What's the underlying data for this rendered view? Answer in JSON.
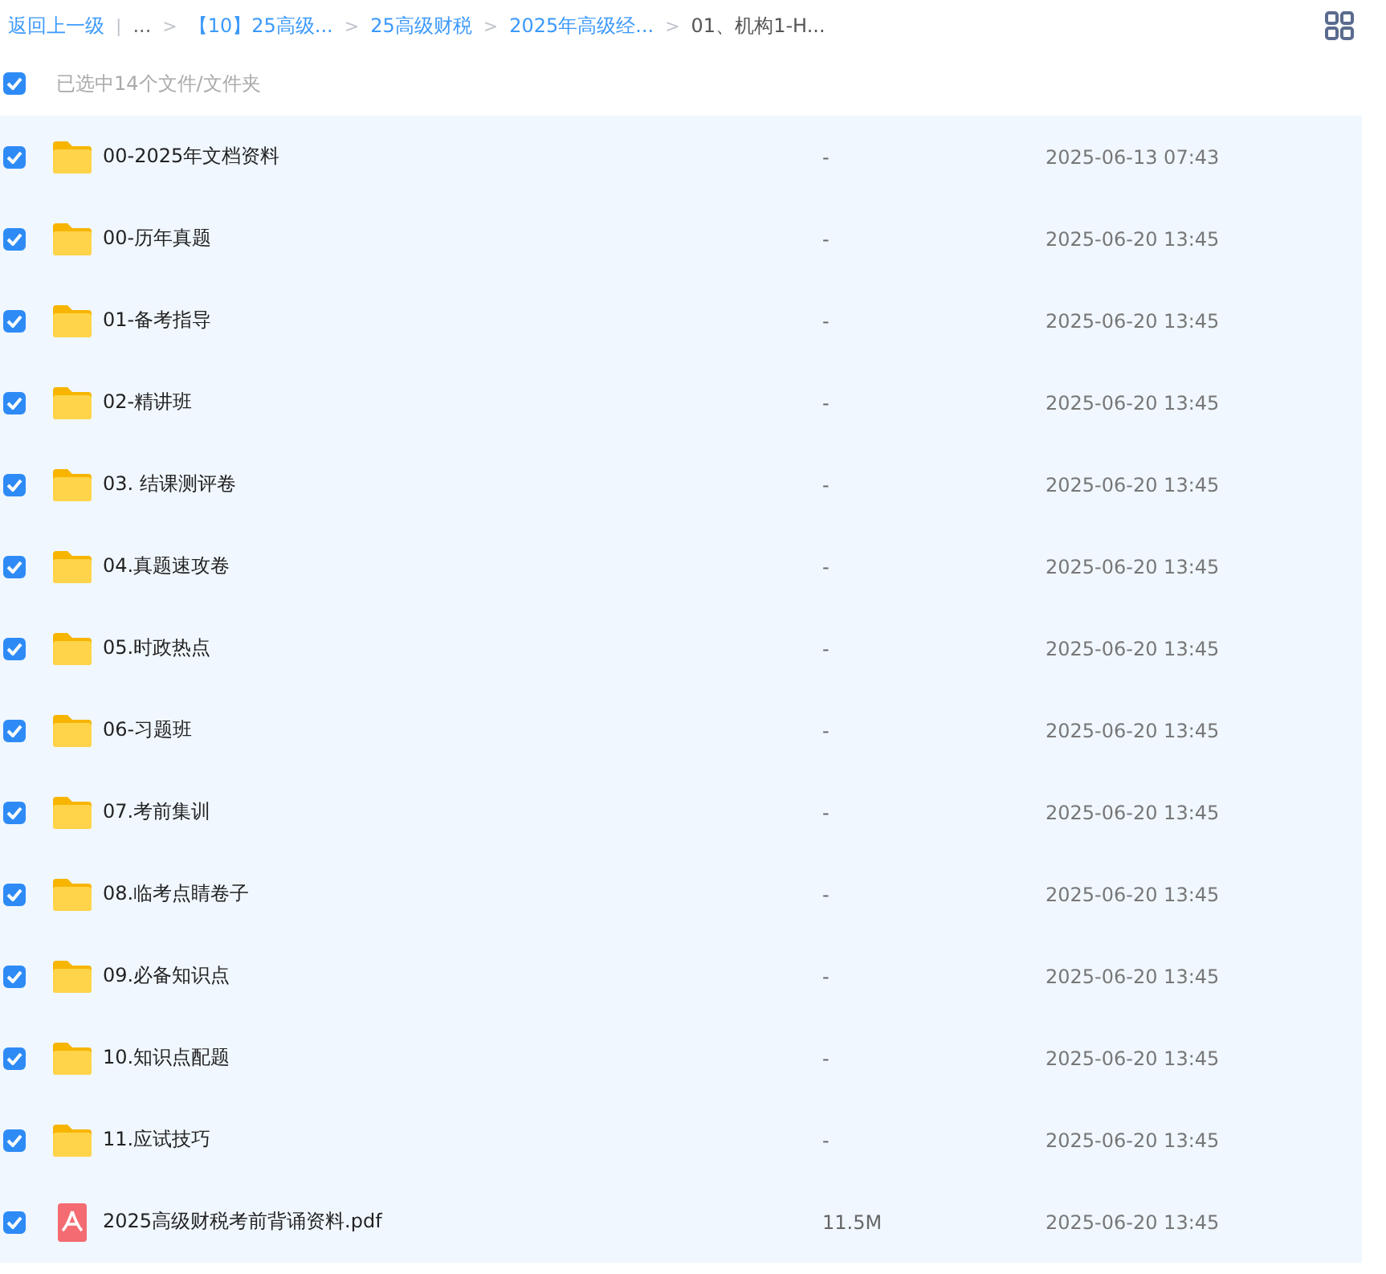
{
  "breadcrumb": {
    "back": "返回上一级",
    "divider": "|",
    "items": [
      {
        "label": "...",
        "kind": "ellipsis"
      },
      {
        "sep": ">",
        "label": "【10】25高级...",
        "kind": "link"
      },
      {
        "sep": ">",
        "label": "25高级财税",
        "kind": "link"
      },
      {
        "sep": ">",
        "label": "2025年高级经...",
        "kind": "link"
      },
      {
        "sep": ">",
        "label": "01、机构1-H...",
        "kind": "current"
      }
    ]
  },
  "select_all": {
    "checked": true,
    "label": "已选中14个文件/文件夹"
  },
  "files": [
    {
      "kind": "folder",
      "name": "00-2025年文档资料",
      "size": "-",
      "date": "2025-06-13 07:43",
      "checked": true
    },
    {
      "kind": "folder",
      "name": "00-历年真题",
      "size": "-",
      "date": "2025-06-20 13:45",
      "checked": true
    },
    {
      "kind": "folder",
      "name": "01-备考指导",
      "size": "-",
      "date": "2025-06-20 13:45",
      "checked": true
    },
    {
      "kind": "folder",
      "name": "02-精讲班",
      "size": "-",
      "date": "2025-06-20 13:45",
      "checked": true
    },
    {
      "kind": "folder",
      "name": "03. 结课测评卷",
      "size": "-",
      "date": "2025-06-20 13:45",
      "checked": true
    },
    {
      "kind": "folder",
      "name": "04.真题速攻卷",
      "size": "-",
      "date": "2025-06-20 13:45",
      "checked": true
    },
    {
      "kind": "folder",
      "name": "05.时政热点",
      "size": "-",
      "date": "2025-06-20 13:45",
      "checked": true
    },
    {
      "kind": "folder",
      "name": "06-习题班",
      "size": "-",
      "date": "2025-06-20 13:45",
      "checked": true
    },
    {
      "kind": "folder",
      "name": "07.考前集训",
      "size": "-",
      "date": "2025-06-20 13:45",
      "checked": true
    },
    {
      "kind": "folder",
      "name": "08.临考点睛卷子",
      "size": "-",
      "date": "2025-06-20 13:45",
      "checked": true
    },
    {
      "kind": "folder",
      "name": "09.必备知识点",
      "size": "-",
      "date": "2025-06-20 13:45",
      "checked": true
    },
    {
      "kind": "folder",
      "name": "10.知识点配题",
      "size": "-",
      "date": "2025-06-20 13:45",
      "checked": true
    },
    {
      "kind": "folder",
      "name": "11.应试技巧",
      "size": "-",
      "date": "2025-06-20 13:45",
      "checked": true
    },
    {
      "kind": "pdf",
      "name": "2025高级财税考前背诵资料.pdf",
      "size": "11.5M",
      "date": "2025-06-20 13:45",
      "checked": true
    }
  ]
}
